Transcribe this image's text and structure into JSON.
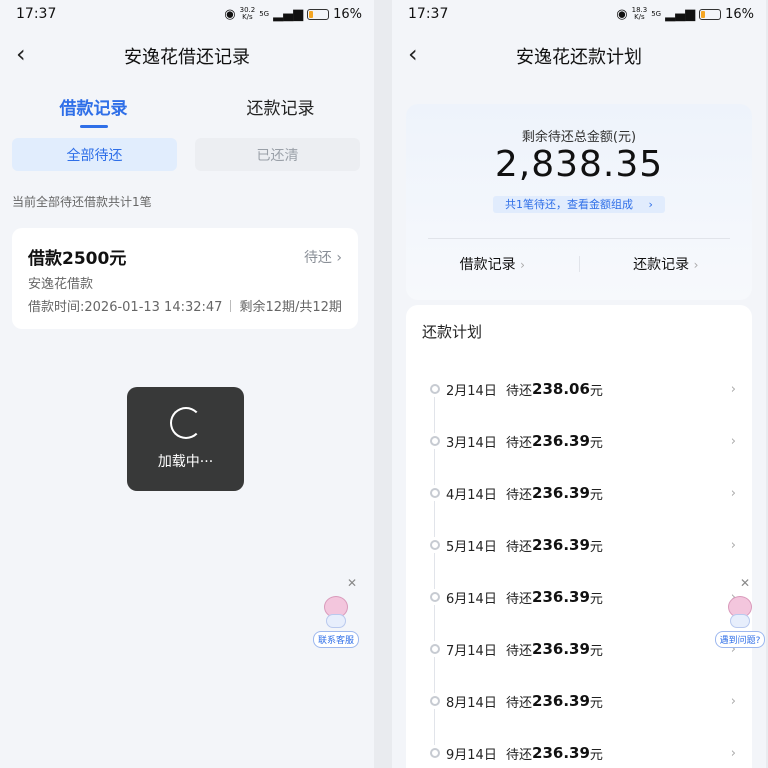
{
  "left": {
    "status": {
      "time": "17:37",
      "net_speed": "30.2",
      "net_unit": "K/s",
      "net_type": "5G",
      "battery": "16%"
    },
    "nav_title": "安逸花借还记录",
    "tabs": [
      "借款记录",
      "还款记录"
    ],
    "active_tab": "借款记录",
    "filters": [
      "全部待还",
      "已还清"
    ],
    "active_filter": "全部待还",
    "count_tip": "当前全部待还借款共计1笔",
    "loan": {
      "title": "借款2500元",
      "status": "待还",
      "product": "安逸花借款",
      "time": "借款时间:2026-01-13 14:32:47",
      "remaining": "剩余12期/共12期"
    },
    "loading_text": "加载中···",
    "service_label": "联系客服"
  },
  "right": {
    "status": {
      "time": "17:37",
      "net_speed": "18.3",
      "net_unit": "K/s",
      "net_type": "5G",
      "battery": "16%"
    },
    "nav_title": "安逸花还款计划",
    "summary_label": "剩余待还总金额(元)",
    "summary_amount": "2,838.35",
    "summary_link": "共1笔待还，查看金额组成",
    "links": [
      "借款记录",
      "还款记录"
    ],
    "plan_title": "还款计划",
    "pending_label": "待还",
    "unit": "元",
    "plan": [
      {
        "date": "2月14日",
        "amount": "238.06"
      },
      {
        "date": "3月14日",
        "amount": "236.39"
      },
      {
        "date": "4月14日",
        "amount": "236.39"
      },
      {
        "date": "5月14日",
        "amount": "236.39"
      },
      {
        "date": "6月14日",
        "amount": "236.39"
      },
      {
        "date": "7月14日",
        "amount": "236.39"
      },
      {
        "date": "8月14日",
        "amount": "236.39"
      },
      {
        "date": "9月14日",
        "amount": "236.39"
      }
    ],
    "help_label": "遇到问题?"
  },
  "icons": {
    "back": "chevron-left-icon",
    "chevron": "chevron-right-icon",
    "close": "close-icon",
    "eye": "eye-icon",
    "signal": "signal-icon",
    "battery": "battery-icon",
    "mascot": "mascot-icon"
  },
  "colors": {
    "accent": "#2f6fe8",
    "toast_bg": "#282828",
    "battery": "#f5a623"
  }
}
